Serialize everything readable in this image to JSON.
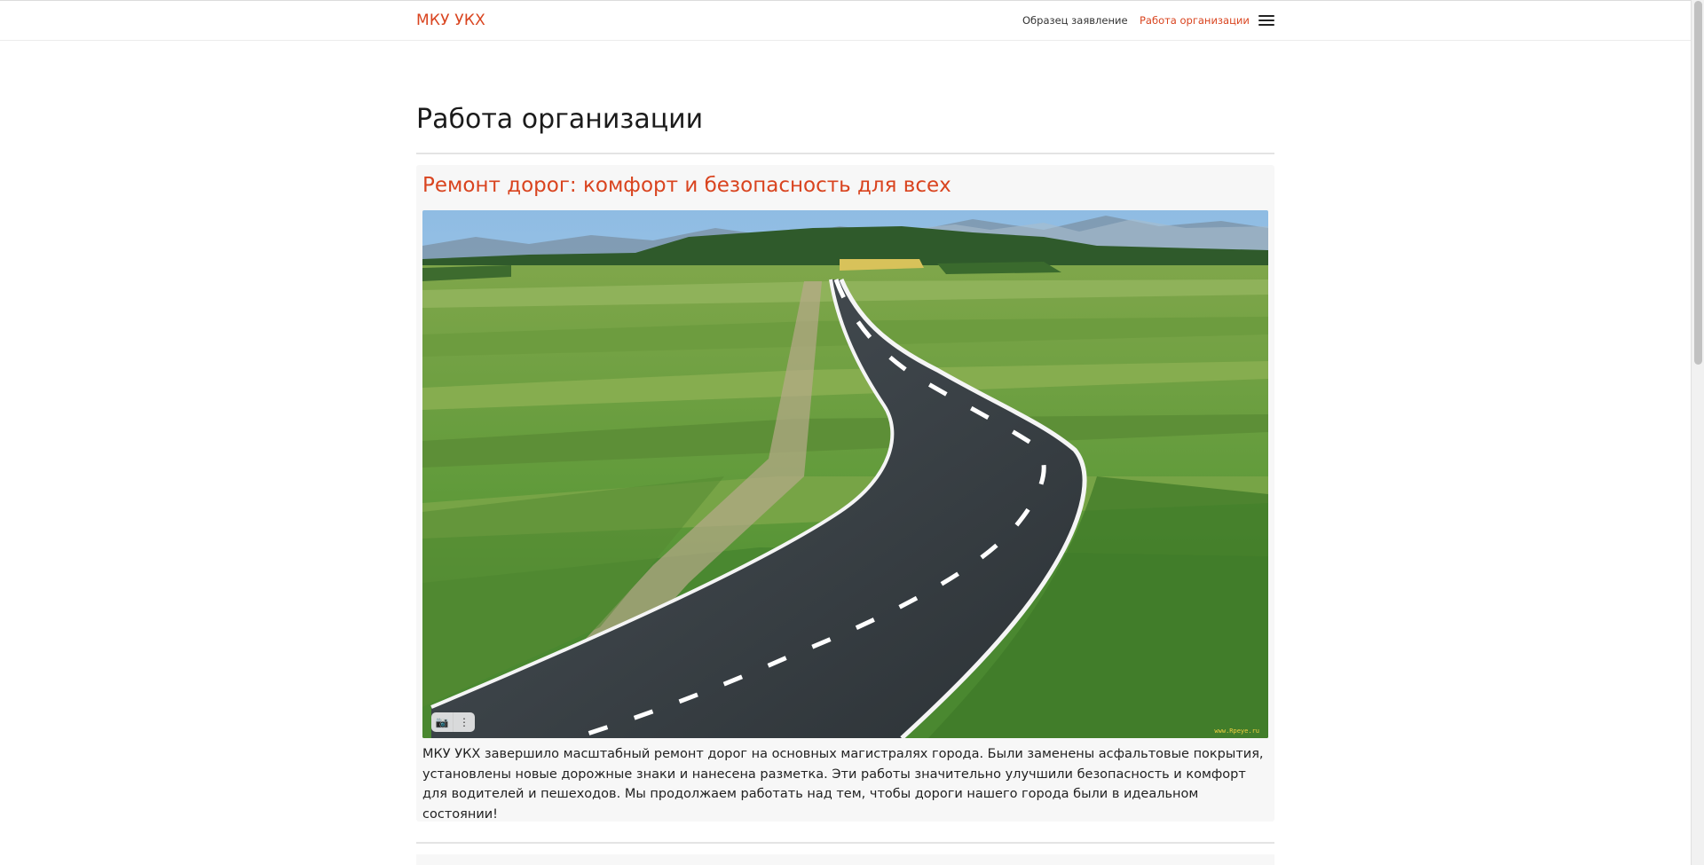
{
  "header": {
    "brand": "МКУ УКХ",
    "nav": [
      {
        "label": "Образец заявление"
      },
      {
        "label": "Работа организации",
        "active": true
      }
    ],
    "menu_icon": "hamburger-menu-icon"
  },
  "main": {
    "page_title": "Работа организации",
    "posts": [
      {
        "title": "Ремонт дорог: комфорт и безопасность для всех",
        "image_description_icon": "landscape-photo",
        "image_tools": [
          {
            "icon": "camera-icon",
            "glyph": "📷"
          },
          {
            "icon": "more-vertical-icon",
            "glyph": "⋮"
          }
        ],
        "watermark": "www.Rpeye.ru",
        "text": "МКУ УКХ завершило масштабный ремонт дорог на основных магистралях города. Были заменены асфальтовые покрытия, установлены новые дорожные знаки и нанесена разметка. Эти работы значительно улучшили безопасность и комфорт для водителей и пешеходов. Мы продолжаем работать над тем, чтобы дороги нашего города были в идеальном состоянии!"
      }
    ]
  },
  "colors": {
    "accent": "#d9441f",
    "card_background": "#f7f7f7",
    "text": "#222222"
  }
}
